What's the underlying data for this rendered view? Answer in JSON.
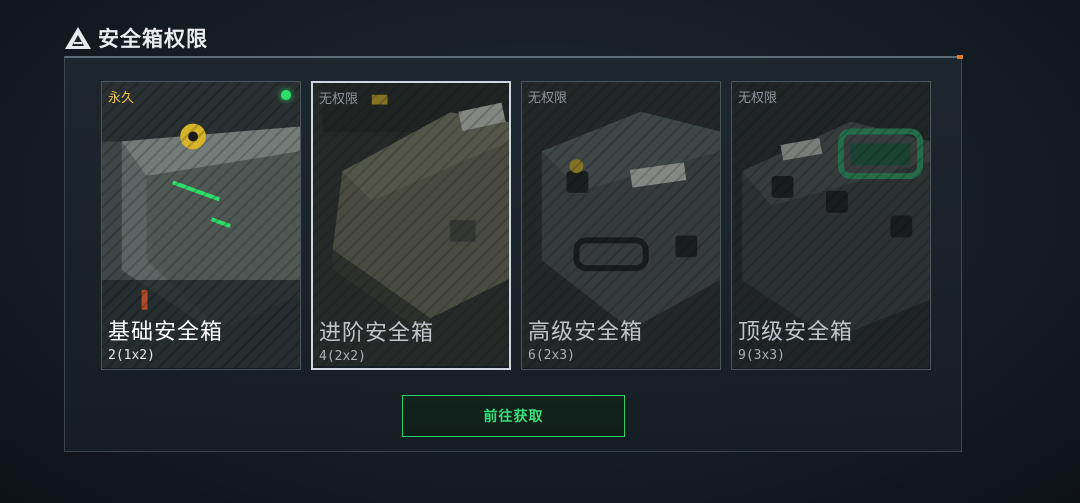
{
  "header": {
    "title": "安全箱权限",
    "logo_icon": "triangle-logo-icon"
  },
  "colors": {
    "accent_green": "#2ee06a",
    "permanent_yellow": "#e8c24a",
    "corner_orange": "#e07a2e"
  },
  "cards": [
    {
      "status": "永久",
      "name": "基础安全箱",
      "size": "2(1x2)",
      "owned": true
    },
    {
      "status": "无权限",
      "name": "进阶安全箱",
      "size": "4(2x2)",
      "owned": false
    },
    {
      "status": "无权限",
      "name": "高级安全箱",
      "size": "6(2x3)",
      "owned": false
    },
    {
      "status": "无权限",
      "name": "顶级安全箱",
      "size": "9(3x3)",
      "owned": false
    }
  ],
  "action": {
    "label": "前往获取"
  }
}
